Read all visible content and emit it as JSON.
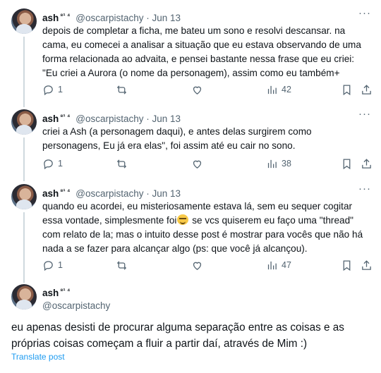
{
  "replies": [
    {
      "name": "ash",
      "name_badge": "⁸¹ ⁴",
      "handle_date": "@oscarpistachy · Jun 13",
      "text": "depois de completar a ficha, me bateu um sono e resolvi descansar. na cama, eu comecei a analisar a situação que eu estava observando de uma forma relacionada ao advaita, e pensei bastante nessa frase que eu criei: \"Eu criei a Aurora (o nome da personagem), assim como eu também+",
      "text_after_emoji": "",
      "replies_count": "1",
      "views": "42"
    },
    {
      "name": "ash",
      "name_badge": "⁸¹ ⁴",
      "handle_date": "@oscarpistachy · Jun 13",
      "text": "criei a Ash (a personagem daqui), e antes delas surgirem como personagens, Eu já era elas\", foi assim até eu cair no sono.",
      "text_after_emoji": "",
      "replies_count": "1",
      "views": "38"
    },
    {
      "name": "ash",
      "name_badge": "⁸¹ ⁴",
      "handle_date": "@oscarpistachy · Jun 13",
      "text": "quando eu acordei, eu misteriosamente estava lá, sem eu sequer cogitar essa vontade, simplesmente foi",
      "text_after_emoji": " se vcs quiserem eu faço uma \"thread\" com relato de la; mas o intuito desse post é mostrar para vocês que não há nada a se fazer para alcançar algo (ps: que você já alcançou).",
      "replies_count": "1",
      "views": "47"
    }
  ],
  "main": {
    "name": "ash",
    "name_badge": "⁸¹ ⁴",
    "handle": "@oscarpistachy",
    "text": "eu apenas desisti de procurar alguma separação entre as coisas e as próprias coisas começam a fluir a partir daí, através de Mim :)",
    "translate": "Translate post"
  },
  "icons": {
    "reply": "reply-icon",
    "repost": "repost-icon",
    "like": "like-icon",
    "views": "views-icon",
    "bookmark": "bookmark-icon",
    "share": "share-icon",
    "more": "more-icon"
  },
  "colors": {
    "text": "#0f1419",
    "muted": "#536471",
    "link": "#1d9bf0",
    "thread_line": "#cfd9de"
  }
}
